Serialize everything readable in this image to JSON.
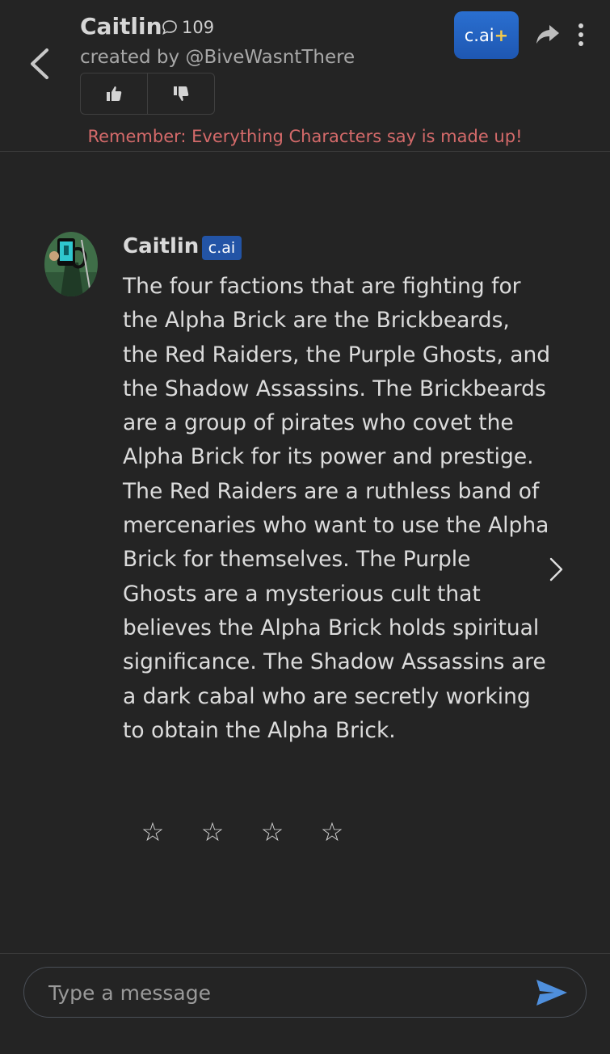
{
  "header": {
    "character_name": "Caitlin",
    "chat_count": "109",
    "creator": "created by @BiveWasntThere",
    "plus_badge": {
      "text": "c.ai",
      "plus": "+"
    },
    "disclaimer": "Remember: Everything Characters say is made up!"
  },
  "message": {
    "sender": "Caitlin",
    "badge": "c.ai",
    "text": "The four factions that are fighting for the Alpha Brick are the Brickbeards, the Red Raiders, the Purple Ghosts, and the Shadow Assassins. The Brickbeards are a group of pirates who covet the Alpha Brick for its power and prestige. The Red Raiders are a ruthless band of mercenaries who want to use the Alpha Brick for themselves. The Purple Ghosts are a mysterious cult that believes the Alpha Brick holds spiritual significance. The Shadow Assassins are a dark cabal who are secretly working to obtain the Alpha Brick.",
    "rating": {
      "stars_total": 4,
      "stars_filled": 0,
      "star_glyph": "☆"
    }
  },
  "composer": {
    "placeholder": "Type a message",
    "value": ""
  },
  "icons": {
    "back": "chevron-left-icon",
    "chat_count": "speech-bubble-icon",
    "upvote": "thumbs-up-icon",
    "downvote": "thumbs-down-icon",
    "share": "share-arrow-icon",
    "more": "vertical-dots-icon",
    "next": "chevron-right-icon",
    "send": "send-icon"
  },
  "colors": {
    "background": "#242424",
    "accent_blue": "#2a6fd0",
    "disclaimer": "#d46a6a",
    "send": "#4f8fdc"
  }
}
